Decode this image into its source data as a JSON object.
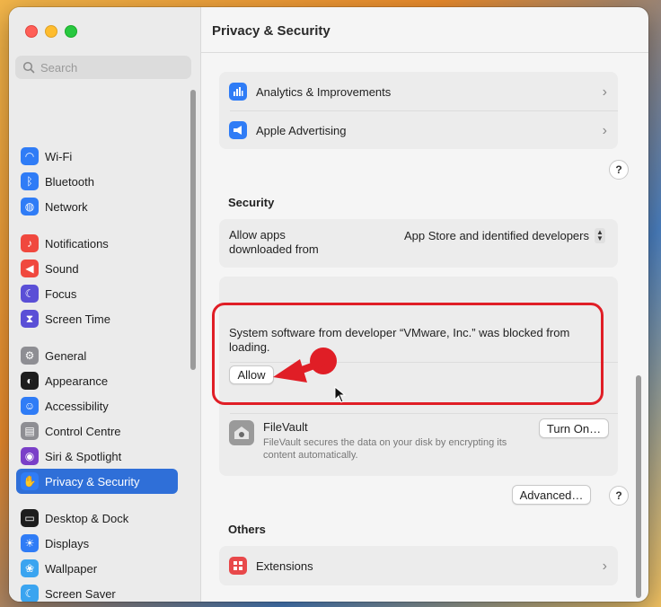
{
  "window": {
    "title": "Privacy & Security"
  },
  "search": {
    "placeholder": "Search"
  },
  "sidebar": {
    "items": [
      {
        "label": "Wi-Fi",
        "icon": "wifi-icon",
        "color": "#2f7cf6"
      },
      {
        "label": "Bluetooth",
        "icon": "bluetooth-icon",
        "color": "#2f7cf6"
      },
      {
        "label": "Network",
        "icon": "globe-icon",
        "color": "#2f7cf6"
      },
      {
        "label": "Notifications",
        "icon": "bell-icon",
        "color": "#f0483e"
      },
      {
        "label": "Sound",
        "icon": "speaker-icon",
        "color": "#f0483e"
      },
      {
        "label": "Focus",
        "icon": "moon-icon",
        "color": "#5a4fd6"
      },
      {
        "label": "Screen Time",
        "icon": "hourglass-icon",
        "color": "#5a4fd6"
      },
      {
        "label": "General",
        "icon": "gear-icon",
        "color": "#8e8e93"
      },
      {
        "label": "Appearance",
        "icon": "appearance-icon",
        "color": "#1d1d1d"
      },
      {
        "label": "Accessibility",
        "icon": "accessibility-icon",
        "color": "#2f7cf6"
      },
      {
        "label": "Control Centre",
        "icon": "control-centre-icon",
        "color": "#8e8e93"
      },
      {
        "label": "Siri & Spotlight",
        "icon": "siri-icon",
        "color": "#7a3fc8"
      },
      {
        "label": "Privacy & Security",
        "icon": "hand-icon",
        "color": "#2f7cf6",
        "active": true
      },
      {
        "label": "Desktop & Dock",
        "icon": "dock-icon",
        "color": "#1d1d1d"
      },
      {
        "label": "Displays",
        "icon": "sun-icon",
        "color": "#2f7cf6"
      },
      {
        "label": "Wallpaper",
        "icon": "wallpaper-icon",
        "color": "#3aa4f0"
      },
      {
        "label": "Screen Saver",
        "icon": "screensaver-icon",
        "color": "#3aa4f0"
      }
    ]
  },
  "privacy_rows": [
    {
      "label": "Analytics & Improvements",
      "icon": "analytics-icon",
      "color": "#2f7cf6"
    },
    {
      "label": "Apple Advertising",
      "icon": "megaphone-icon",
      "color": "#2f7cf6"
    }
  ],
  "security": {
    "heading": "Security",
    "allow_label": "Allow apps downloaded from",
    "allow_value": "App Store and identified developers",
    "blocked_message": "System software from developer “VMware, Inc.” was blocked from loading.",
    "allow_button": "Allow",
    "filevault_title": "FileVault",
    "filevault_desc": "FileVault secures the data on your disk by encrypting its content automatically.",
    "turn_on_button": "Turn On…",
    "advanced_button": "Advanced…",
    "help_glyph": "?"
  },
  "others": {
    "heading": "Others",
    "extensions_label": "Extensions"
  },
  "annotation": {
    "color": "#e01e26"
  }
}
